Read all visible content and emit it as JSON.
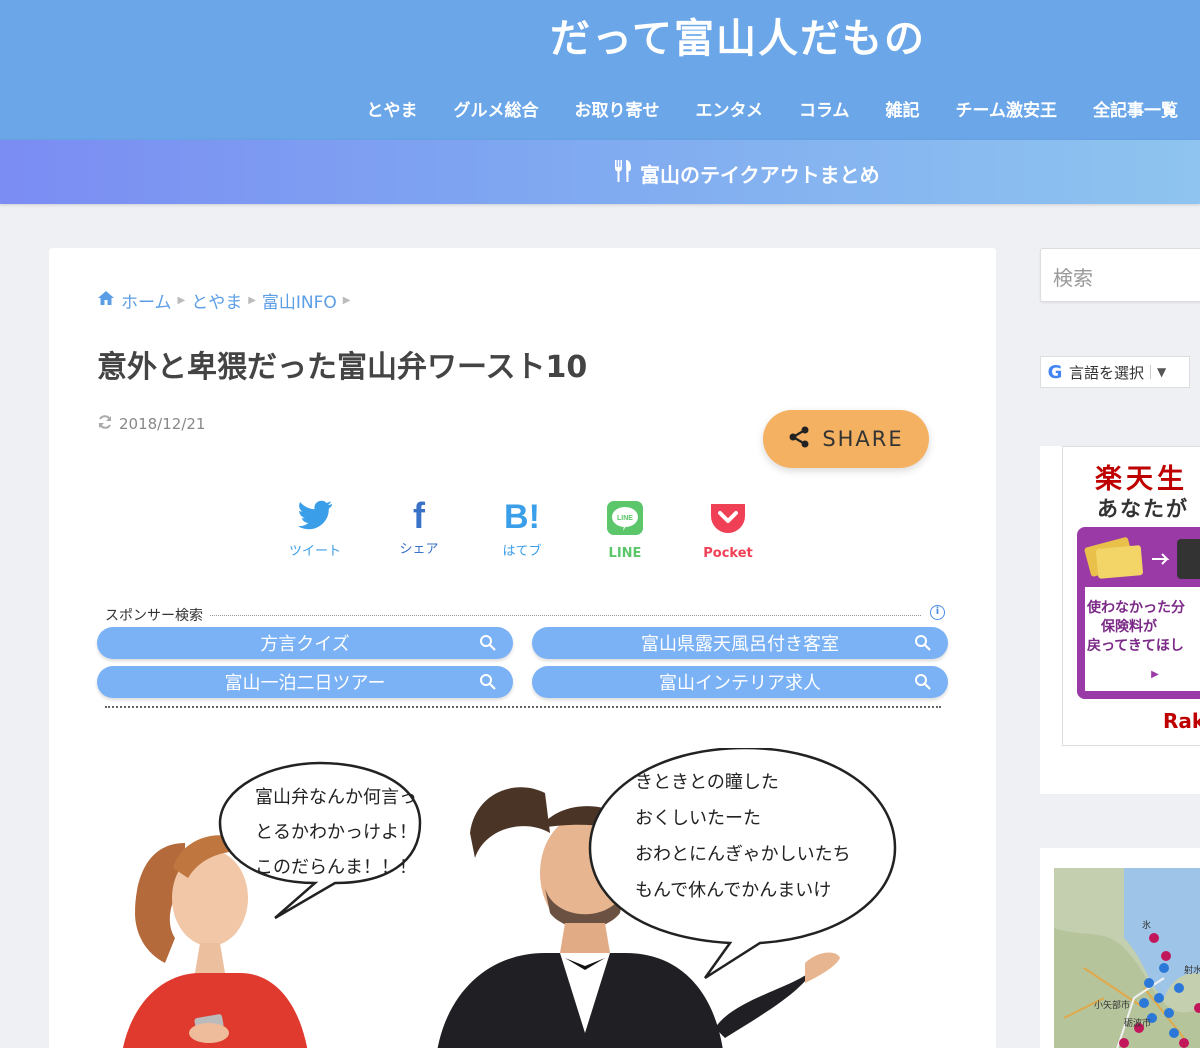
{
  "site": {
    "title": "だって富山人だもの"
  },
  "nav": {
    "items": [
      "とやま",
      "グルメ総合",
      "お取り寄せ",
      "エンタメ",
      "コラム",
      "雑記",
      "チーム激安王",
      "全記事一覧"
    ]
  },
  "banner": {
    "label": "富山のテイクアウトまとめ"
  },
  "breadcrumb": {
    "home": "ホーム",
    "cat1": "とやま",
    "cat2": "富山INFO"
  },
  "article": {
    "title": "意外と卑猥だった富山弁ワースト10",
    "date": "2018/12/21",
    "share_label": "SHARE"
  },
  "social": {
    "twitter": "ツイート",
    "facebook": "シェア",
    "hatena": "はてブ",
    "hatena_mark": "B!",
    "line": "LINE",
    "pocket": "Pocket"
  },
  "sponsor": {
    "label": "スポンサー検索",
    "links": [
      "方言クイズ",
      "富山県露天風呂付き客室",
      "富山一泊二日ツアー",
      "富山インテリア求人"
    ]
  },
  "hero": {
    "bubble_left": [
      "富山弁なんか何言っ",
      "とるかわかっけよ！",
      "このだらんま！！！"
    ],
    "bubble_right": [
      "きときとの瞳した",
      "おくしいたーた",
      "おわとにんぎゃかしいたち",
      "もんで休んでかんまいけ"
    ]
  },
  "sidebar": {
    "search_placeholder": "検索",
    "translate_label": "言語を選択",
    "translate_arrow": "▼",
    "ad_title": "楽天生",
    "ad_sub": "あなたが",
    "ad_card_lines": [
      "使わなかった分",
      "保険料が",
      "戻ってきてほし"
    ],
    "ad_logo": "Rak",
    "map_labels": [
      "氷",
      "小矢部市",
      "砺波市",
      "射水市"
    ]
  },
  "colors": {
    "header": "#6aa6e8",
    "accent": "#5c9ee6",
    "share": "#f4b161",
    "pill": "#7bb2f5"
  }
}
